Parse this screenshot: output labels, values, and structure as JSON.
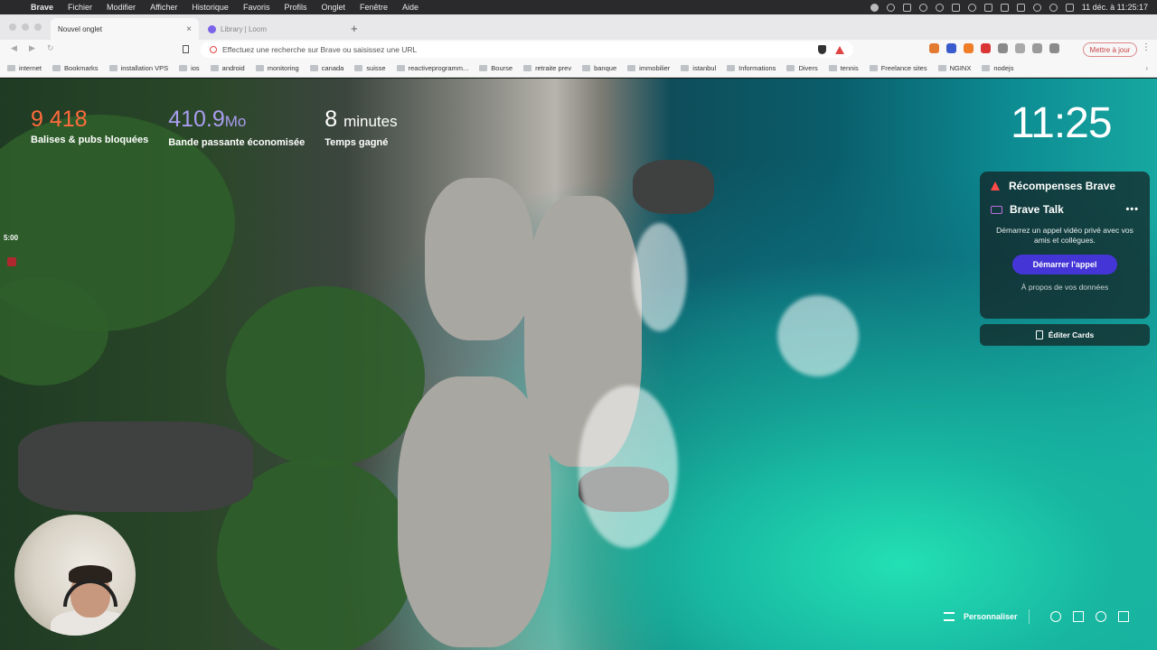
{
  "menubar": {
    "items": [
      "Brave",
      "Fichier",
      "Modifier",
      "Afficher",
      "Historique",
      "Favoris",
      "Profils",
      "Onglet",
      "Fenêtre",
      "Aide"
    ],
    "datetime": "11 déc. à  11:25:17"
  },
  "tabs": [
    {
      "label": "Nouvel onglet",
      "active": true
    },
    {
      "label": "Library | Loom",
      "active": false
    }
  ],
  "toolbar": {
    "url_placeholder": "Effectuez une recherche sur Brave ou saisissez une URL",
    "update_label": "Mettre à jour"
  },
  "bookmarks": [
    "internet",
    "Bookmarks",
    "installation VPS",
    "ios",
    "android",
    "monitoring",
    "canada",
    "suisse",
    "reactiveprogramm...",
    "Bourse",
    "retraite prev",
    "banque",
    "immobilier",
    "istanbul",
    "Informations",
    "Divers",
    "tennis",
    "Freelance sites",
    "NGINX",
    "nodejs"
  ],
  "stats": {
    "blocked": {
      "value": "9 418",
      "label": "Balises & pubs bloquées"
    },
    "bandwidth": {
      "value": "410.9",
      "unit": "Mo",
      "label": "Bande passante économisée"
    },
    "time": {
      "value": "8",
      "unit": "minutes",
      "label": "Temps gagné"
    }
  },
  "clock": "11:25",
  "cards": {
    "rewards_title": "Récompenses Brave",
    "talk_title": "Brave Talk",
    "talk_description": "Démarrez un appel vidéo privé avec vos amis et collègues.",
    "talk_button": "Démarrer l'appel",
    "talk_link": "À propos de vos données",
    "edit_label": "Éditer Cards"
  },
  "recording": {
    "timer": "5:00"
  },
  "bottom": {
    "customize_label": "Personnaliser"
  },
  "colors": {
    "blocked": "#ff6b3d",
    "bandwidth": "#a99df0",
    "talk_button": "#4436d6",
    "rewards_icon": "#ff4a4a"
  }
}
